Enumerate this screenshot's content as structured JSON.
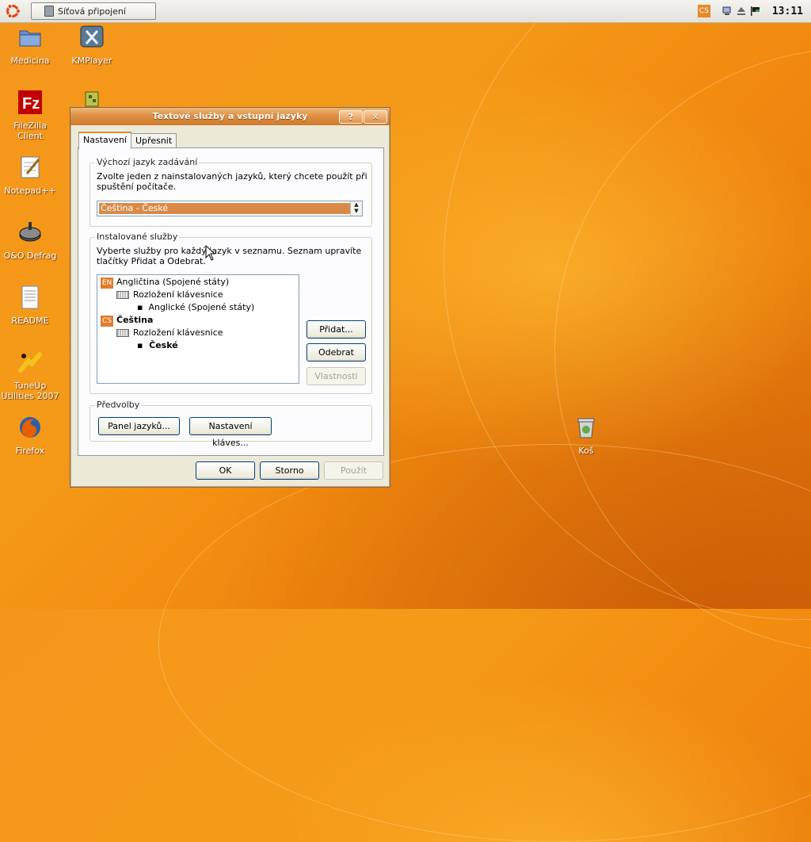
{
  "top_panel": {
    "task_button_label": "Síťová připojení",
    "language_indicator": "CS",
    "clock": "13:11"
  },
  "desktop_icons": [
    {
      "label": "Medicina",
      "icon": "folder-icon"
    },
    {
      "label": "KMPlayer",
      "icon": "kmplayer-icon"
    },
    {
      "label": "FileZilla Client",
      "icon": "filezilla-icon"
    },
    {
      "label": "Notepad++",
      "icon": "notepad-icon"
    },
    {
      "label": "O&O Defrag",
      "icon": "defrag-icon"
    },
    {
      "label": "README",
      "icon": "document-icon"
    },
    {
      "label": "TuneUp Utilities 2007",
      "icon": "tuneup-icon"
    },
    {
      "label": "Firefox",
      "icon": "firefox-icon"
    },
    {
      "label": "Koš",
      "icon": "trash-icon"
    }
  ],
  "dialog": {
    "title": "Textové služby a vstupní jazyky",
    "help_button": "?",
    "close_button": "✕",
    "tabs": [
      "Nastavení",
      "Upřesnit"
    ],
    "default_language": {
      "group_label": "Výchozí jazyk zadávání",
      "description": "Zvolte jeden z nainstalovaných jazyků, který chcete použít při spuštění počítače.",
      "selected": "Čeština - České"
    },
    "installed_services": {
      "group_label": "Instalované služby",
      "description": "Vyberte služby pro každý jazyk v seznamu. Seznam upravíte tlačítky Přidat a Odebrat.",
      "tree": {
        "lang1_badge": "EN",
        "lang1_name": "Angličtina (Spojené státy)",
        "lang1_category": "Rozložení klávesnice",
        "lang1_item": "Anglické (Spojené státy)",
        "lang2_badge": "CS",
        "lang2_name": "Čeština",
        "lang2_category": "Rozložení klávesnice",
        "lang2_item": "České"
      },
      "add_button": "Přidat...",
      "remove_button": "Odebrat",
      "properties_button": "Vlastnosti"
    },
    "preferences": {
      "group_label": "Předvolby",
      "language_bar_button": "Panel jazyků...",
      "key_settings_button": "Nastavení kláves..."
    },
    "ok_button": "OK",
    "cancel_button": "Storno",
    "apply_button": "Použít"
  },
  "colors": {
    "accent": "#d98a47",
    "desktop": "#f5961c"
  }
}
